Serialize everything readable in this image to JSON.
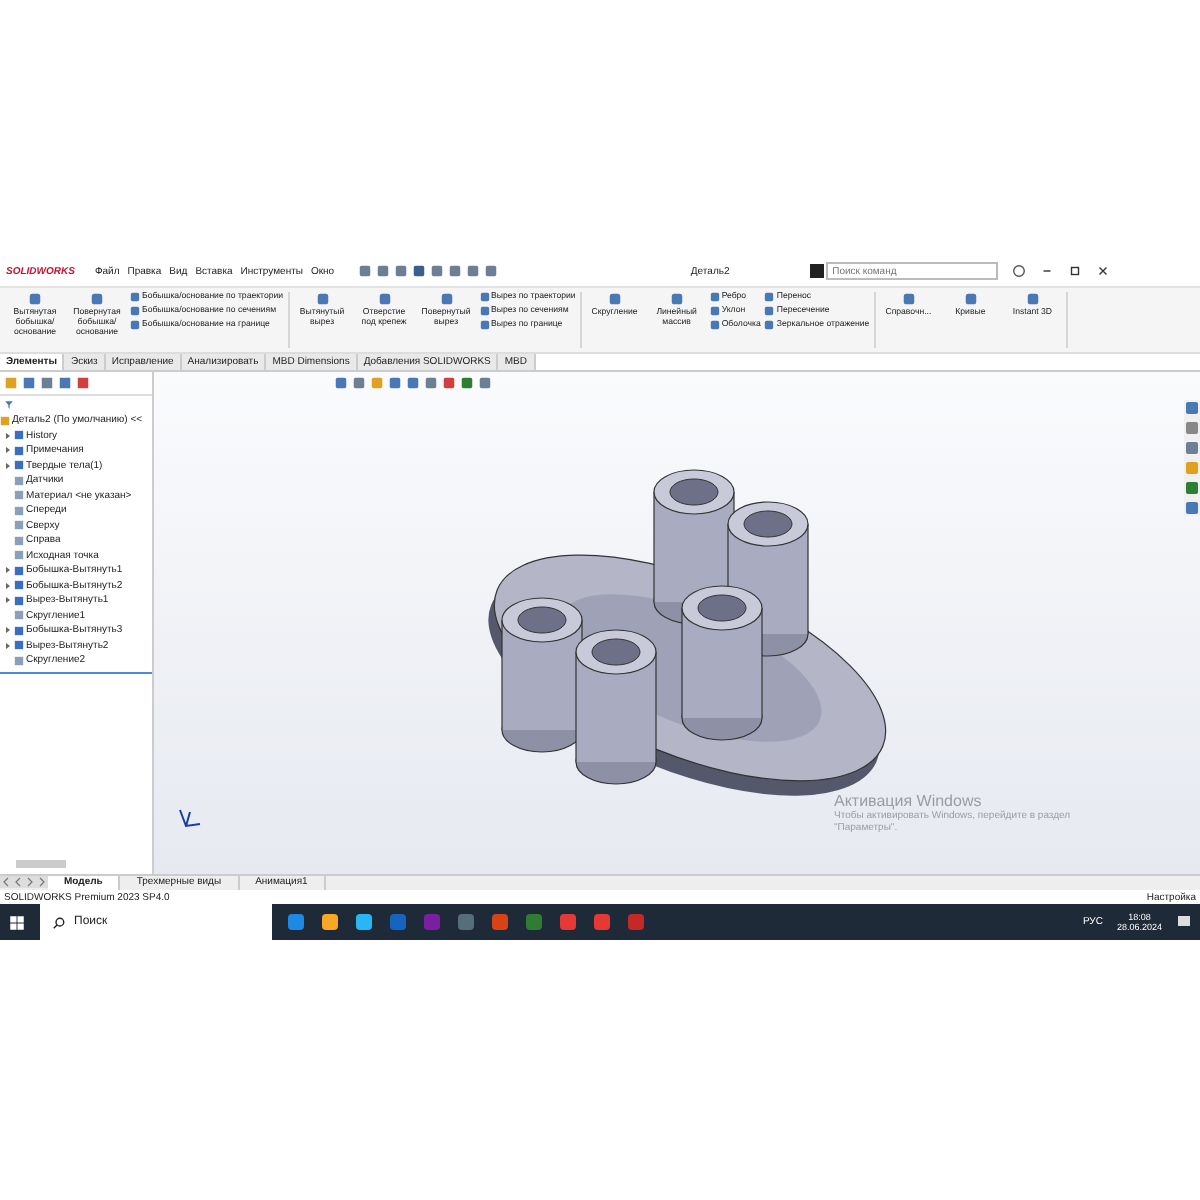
{
  "title_bar": {
    "logo": "SOLIDWORKS",
    "menu": [
      "Файл",
      "Правка",
      "Вид",
      "Вставка",
      "Инструменты",
      "Окно"
    ],
    "title": "Деталь2",
    "search": {
      "placeholder": "Поиск команд"
    }
  },
  "command_manager": {
    "groups": [
      {
        "items": [
          {
            "kind": "large",
            "label": "Вытянутая бобышка/основание"
          },
          {
            "kind": "large",
            "label": "Повернутая бобышка/основание"
          },
          {
            "kind": "stack",
            "labels": [
              "Бобышка/основание по траектории",
              "Бобышка/основание по сечениям",
              "Бобышка/основание на границе"
            ]
          }
        ]
      },
      {
        "items": [
          {
            "kind": "large",
            "label": "Вытянутый вырез"
          },
          {
            "kind": "large",
            "label": "Отверстие под крепеж"
          },
          {
            "kind": "large",
            "label": "Повернутый вырез"
          },
          {
            "kind": "stack",
            "labels": [
              "Вырез по траектории",
              "Вырез по сечениям",
              "Вырез по границе"
            ]
          }
        ]
      },
      {
        "items": [
          {
            "kind": "large",
            "label": "Скругление"
          },
          {
            "kind": "large",
            "label": "Линейный массив"
          },
          {
            "kind": "stack",
            "labels": [
              "Ребро",
              "Уклон",
              "Оболочка"
            ]
          },
          {
            "kind": "stack",
            "labels": [
              "Перенос",
              "Пересечение",
              "Зеркальное отражение"
            ]
          }
        ]
      },
      {
        "items": [
          {
            "kind": "large",
            "label": "Справочн..."
          },
          {
            "kind": "large",
            "label": "Кривые"
          },
          {
            "kind": "large",
            "label": "Instant 3D"
          }
        ]
      }
    ]
  },
  "tabs": [
    {
      "label": "Элементы",
      "selected": true
    },
    {
      "label": "Эскиз",
      "selected": false
    },
    {
      "label": "Исправление",
      "selected": false
    },
    {
      "label": "Анализировать",
      "selected": false
    },
    {
      "label": "MBD Dimensions",
      "selected": false
    },
    {
      "label": "Добавления SOLIDWORKS",
      "selected": false
    },
    {
      "label": "MBD",
      "selected": false
    }
  ],
  "feature_tree": {
    "root": "Деталь2 (По умолчанию) <<",
    "children": [
      {
        "label": "History",
        "expandable": true
      },
      {
        "label": "Примечания",
        "expandable": true
      },
      {
        "label": "Твердые тела(1)",
        "expandable": true
      },
      {
        "label": "Датчики",
        "expandable": false
      },
      {
        "label": "Материал <не указан>",
        "expandable": false
      },
      {
        "label": "Спереди",
        "expandable": false
      },
      {
        "label": "Сверху",
        "expandable": false
      },
      {
        "label": "Справа",
        "expandable": false
      },
      {
        "label": "Исходная точка",
        "expandable": false
      },
      {
        "label": "Бобышка-Вытянуть1",
        "expandable": true
      },
      {
        "label": "Бобышка-Вытянуть2",
        "expandable": true
      },
      {
        "label": "Вырез-Вытянуть1",
        "expandable": true
      },
      {
        "label": "Скругление1",
        "expandable": false
      },
      {
        "label": "Бобышка-Вытянуть3",
        "expandable": true
      },
      {
        "label": "Вырез-Вытянуть2",
        "expandable": true
      },
      {
        "label": "Скругление2",
        "expandable": false
      }
    ]
  },
  "activation_notice": {
    "title": "Активация Windows",
    "text": "Чтобы активировать Windows, перейдите в раздел \"Параметры\"."
  },
  "bottom_tabs": [
    {
      "label": "Модель",
      "selected": true
    },
    {
      "label": "Трехмерные виды",
      "selected": false
    },
    {
      "label": "Анимация1",
      "selected": false
    }
  ],
  "status_bar": {
    "product": "SOLIDWORKS Premium 2023 SP4.0",
    "settings": "Настройка"
  },
  "taskbar": {
    "search": "Поиск",
    "language": "РУС",
    "time": "18:08",
    "date": "28.06.2024"
  }
}
